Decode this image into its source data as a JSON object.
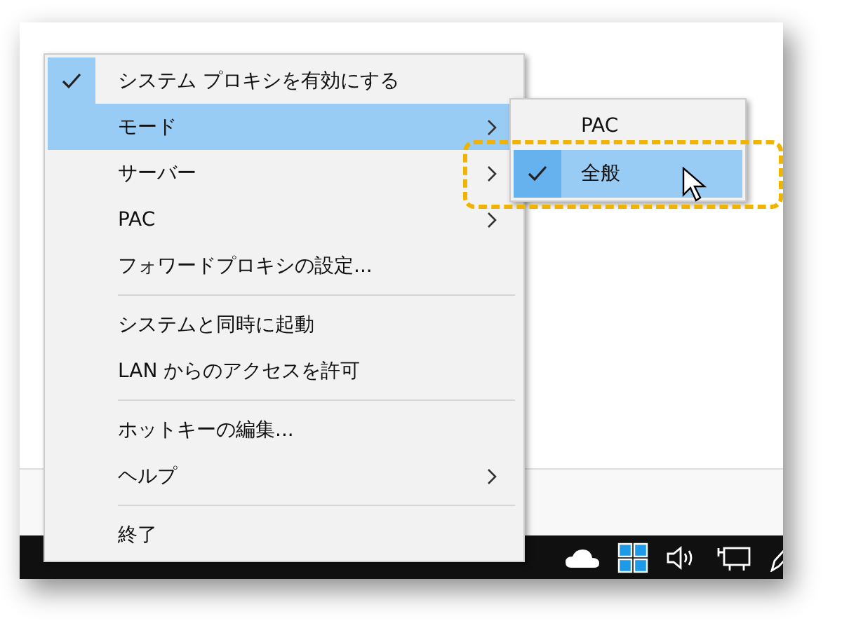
{
  "menu": {
    "items": [
      {
        "kind": "item",
        "label": "システム プロキシを有効にする",
        "checked": true,
        "highlighted": false,
        "submenu": false
      },
      {
        "kind": "item",
        "label": "モード",
        "checked": false,
        "highlighted": true,
        "submenu": true
      },
      {
        "kind": "item",
        "label": "サーバー",
        "checked": false,
        "highlighted": false,
        "submenu": true
      },
      {
        "kind": "item",
        "label": "PAC",
        "checked": false,
        "highlighted": false,
        "submenu": true
      },
      {
        "kind": "item",
        "label": "フォワードプロキシの設定...",
        "checked": false,
        "highlighted": false,
        "submenu": false
      },
      {
        "kind": "separator"
      },
      {
        "kind": "item",
        "label": "システムと同時に起動",
        "checked": false,
        "highlighted": false,
        "submenu": false
      },
      {
        "kind": "item",
        "label": "LAN からのアクセスを許可",
        "checked": false,
        "highlighted": false,
        "submenu": false
      },
      {
        "kind": "separator"
      },
      {
        "kind": "item",
        "label": "ホットキーの編集...",
        "checked": false,
        "highlighted": false,
        "submenu": false
      },
      {
        "kind": "item",
        "label": "ヘルプ",
        "checked": false,
        "highlighted": false,
        "submenu": true
      },
      {
        "kind": "separator"
      },
      {
        "kind": "item",
        "label": "終了",
        "checked": false,
        "highlighted": false,
        "submenu": false
      }
    ]
  },
  "submenu": {
    "items": [
      {
        "label": "PAC",
        "checked": false,
        "highlighted": false
      },
      {
        "label": "全般",
        "checked": true,
        "highlighted": true
      }
    ]
  }
}
